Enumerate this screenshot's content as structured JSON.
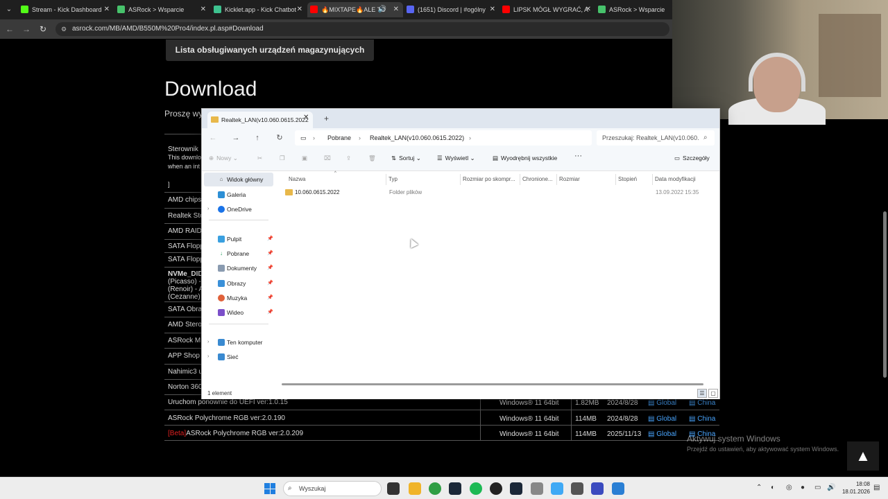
{
  "browser": {
    "tabs": [
      {
        "label": "Stream - Kick Dashboard",
        "color": "#53fc18"
      },
      {
        "label": "ASRock > Wsparcie",
        "color": "#47c26b"
      },
      {
        "label": "Kicklet.app - Kick Chatbot",
        "color": "#3ec28f"
      },
      {
        "label": "🔥MIXTAPE🔥ALE TO",
        "color": "#ff0000"
      },
      {
        "label": "(1651) Discord | #ogólny",
        "color": "#5865f2"
      },
      {
        "label": "LIPSK MÓGŁ WYGRAĆ, A",
        "color": "#ff0000"
      },
      {
        "label": "ASRock > Wsparcie",
        "color": "#47c26b"
      }
    ],
    "url": "asrock.com/MB/AMD/B550M%20Pro4/index.pl.asp#Download"
  },
  "page": {
    "storage_button": "Lista obsługiwanych urządzeń magazynujących",
    "heading": "Download",
    "subtext": "Proszę wy",
    "row_stubs": [
      "Sterownik",
      "This downlo",
      "when an int",
      "]",
      "AMD chips",
      "Realtek Sto",
      "AMD RAID",
      "SATA Flopp",
      "SATA Flopp",
      "NVMe_DID",
      "(Picasso) -",
      "(Renoir) - A",
      "(Cezanne)",
      "SATA Obra",
      "AMD Stero",
      "ASRock M",
      "APP Shop",
      "Nahimic3 u",
      "Norton 360"
    ],
    "rows": [
      {
        "name": "Uruchom ponownie do UEFI ver:1.0.15",
        "os": "Windows® 11 64bit",
        "size": "1.82MB",
        "date": "2024/8/28",
        "global": "Global",
        "china": "China"
      },
      {
        "name": "ASRock Polychrome RGB ver:2.0.190",
        "os": "Windows® 11 64bit",
        "size": "114MB",
        "date": "2024/8/28",
        "global": "Global",
        "china": "China"
      },
      {
        "beta": "[Beta]",
        "name": "ASRock Polychrome RGB ver:2.0.209",
        "os": "Windows® 11 64bit",
        "size": "114MB",
        "date": "2025/11/13",
        "global": "Global",
        "china": "China"
      }
    ]
  },
  "explorer": {
    "tab_title": "Realtek_LAN(v10.060.0615.2022",
    "breadcrumb": [
      "Pobrane",
      "Realtek_LAN(v10.060.0615.2022)"
    ],
    "search_placeholder": "Przeszukaj: Realtek_LAN(v10.060.",
    "toolbar": {
      "new": "Nowy",
      "sort": "Sortuj",
      "view": "Wyświetl",
      "extract": "Wyodrębnij wszystkie",
      "more": "···",
      "details": "Szczegóły"
    },
    "nav": {
      "home": "Widok główny",
      "gallery": "Galeria",
      "onedrive": "OneDrive",
      "desktop": "Pulpit",
      "downloads": "Pobrane",
      "documents": "Dokumenty",
      "pictures": "Obrazy",
      "music": "Muzyka",
      "videos": "Wideo",
      "this_pc": "Ten komputer",
      "network": "Sieć"
    },
    "columns": [
      "Nazwa",
      "Typ",
      "Rozmiar po skompr...",
      "Chronione...",
      "Rozmiar",
      "Stopień",
      "Data modyfikacji"
    ],
    "files": [
      {
        "name": "10.060.0615.2022",
        "type": "Folder plików",
        "modified": "13.09.2022 15:35"
      }
    ],
    "status": "1 element"
  },
  "overlay": {
    "activate_title": "Aktywuj system Windows",
    "activate_sub": "Przejdź do ustawień, aby aktywować system Windows.",
    "scroll_top": "▲"
  },
  "taskbar": {
    "search": "Wyszukaj",
    "time": "18:08",
    "date": "18.01.2026"
  }
}
